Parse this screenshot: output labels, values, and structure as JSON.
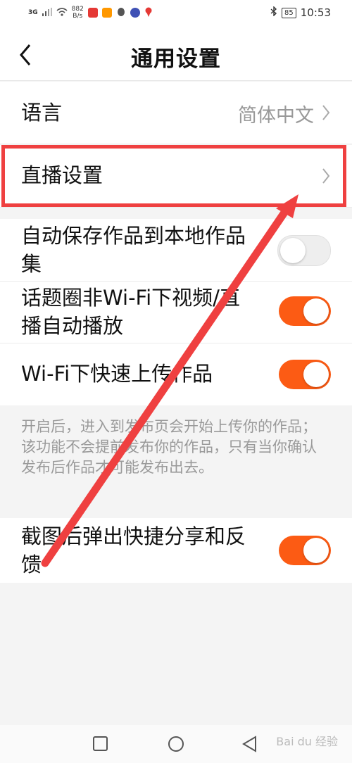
{
  "status_bar": {
    "network": "3G",
    "speed_value": "882",
    "speed_unit": "B/s",
    "battery": "85",
    "time": "10:53"
  },
  "header": {
    "title": "通用设置"
  },
  "settings": {
    "language": {
      "label": "语言",
      "value": "简体中文"
    },
    "live": {
      "label": "直播设置"
    },
    "auto_save": {
      "label_line1": "自动保存作品到本地作品",
      "label_line2": "集",
      "enabled": false
    },
    "topic_autoplay": {
      "label_line1": "话题圈非Wi-Fi下视频/直",
      "label_line2": "播自动播放",
      "enabled": true
    },
    "wifi_upload": {
      "label": "Wi-Fi下快速上传作品",
      "enabled": true
    },
    "hint": "开启后，进入到发布页会开始上传你的作品；该功能不会提前发布你的作品，只有当你确认发布后作品才可能发布出去。",
    "screenshot_share": {
      "label_line1": "截图后弹出快捷分享和反",
      "label_line2": "馈",
      "enabled": true
    }
  },
  "watermark": "Bai du 经验",
  "colors": {
    "accent": "#fc5b14",
    "annotation": "#ef4040"
  }
}
